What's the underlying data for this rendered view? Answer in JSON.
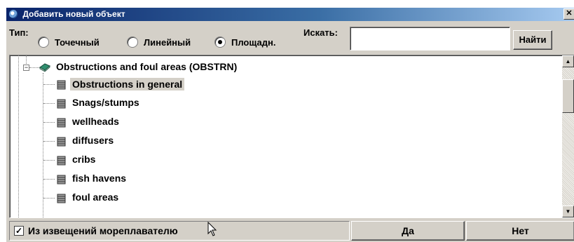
{
  "window": {
    "title": "Добавить новый объект",
    "close_label": "✕"
  },
  "typebar": {
    "type_label": "Тип:",
    "options": [
      {
        "label": "Точечный",
        "selected": false
      },
      {
        "label": "Линейный",
        "selected": false
      },
      {
        "label": "Площадн.",
        "selected": true
      }
    ],
    "search_label": "Искать:",
    "search_value": "",
    "find_label": "Найти"
  },
  "tree": {
    "parent": {
      "label": "Obstructions and foul areas (OBSTRN)",
      "icon": "book-icon",
      "expanded": true
    },
    "children": [
      {
        "label": "Obstructions in general",
        "selected": true
      },
      {
        "label": "Snags/stumps",
        "selected": false
      },
      {
        "label": "wellheads",
        "selected": false
      },
      {
        "label": "diffusers",
        "selected": false
      },
      {
        "label": "cribs",
        "selected": false
      },
      {
        "label": "fish havens",
        "selected": false
      },
      {
        "label": "foul areas",
        "selected": false
      }
    ]
  },
  "bottom": {
    "notice_checked": true,
    "notice_label": "Из извещений мореплавателю",
    "ok_label": "Да",
    "cancel_label": "Нет"
  },
  "colors": {
    "titlebar_start": "#0a246a",
    "titlebar_end": "#a6caf0",
    "face": "#d4d0c8"
  }
}
